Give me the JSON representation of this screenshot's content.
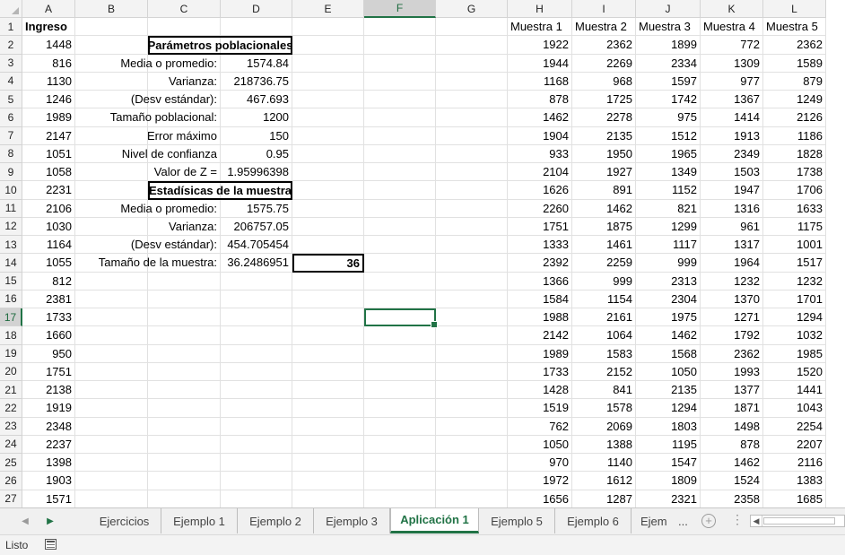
{
  "columns": [
    "A",
    "B",
    "C",
    "D",
    "E",
    "F",
    "G",
    "H",
    "I",
    "J",
    "K",
    "L"
  ],
  "selected_column": "F",
  "selected_row": 17,
  "rows": [
    "1",
    "2",
    "3",
    "4",
    "5",
    "6",
    "7",
    "8",
    "9",
    "10",
    "11",
    "12",
    "13",
    "14",
    "15",
    "16",
    "17",
    "18",
    "19",
    "20",
    "21",
    "22",
    "23",
    "24",
    "25",
    "26",
    "27"
  ],
  "column_a": {
    "header": "Ingreso",
    "values": [
      "1448",
      "816",
      "1130",
      "1246",
      "1989",
      "2147",
      "1051",
      "1058",
      "2231",
      "2106",
      "1030",
      "1164",
      "1055",
      "812",
      "2381",
      "1733",
      "1660",
      "950",
      "1751",
      "2138",
      "1919",
      "2348",
      "2237",
      "1398",
      "1903",
      "1571"
    ]
  },
  "params": {
    "title_poblacion": "Parámetros poblacionales",
    "media_label": "Media o promedio:",
    "media_value": "1574.84",
    "varianza_label": "Varianza:",
    "varianza_value": "218736.75",
    "desv_label": "(Desv estándar):",
    "desv_value": "467.693",
    "tamano_label": "Tamaño poblacional:",
    "tamano_value": "1200",
    "error_label": "Error máximo",
    "error_value": "150",
    "nivel_label": "Nivel de confianza",
    "nivel_value": "0.95",
    "z_label": "Valor de Z =",
    "z_value": "1.95996398",
    "title_muestra": "Estadísicas de la muestra",
    "m_media_label": "Media o promedio:",
    "m_media_value": "1575.75",
    "m_varianza_label": "Varianza:",
    "m_varianza_value": "206757.05",
    "m_desv_label": "(Desv estándar):",
    "m_desv_value": "454.705454",
    "m_tamano_label": "Tamaño de la muestra:",
    "m_tamano_value": "36.2486951",
    "m_tamano_rounded": "36"
  },
  "samples": {
    "headers": [
      "Muestra 1",
      "Muestra 2",
      "Muestra 3",
      "Muestra 4",
      "Muestra 5"
    ],
    "rows": [
      [
        "1922",
        "2362",
        "1899",
        "772",
        "2362"
      ],
      [
        "1944",
        "2269",
        "2334",
        "1309",
        "1589"
      ],
      [
        "1168",
        "968",
        "1597",
        "977",
        "879"
      ],
      [
        "878",
        "1725",
        "1742",
        "1367",
        "1249"
      ],
      [
        "1462",
        "2278",
        "975",
        "1414",
        "2126"
      ],
      [
        "1904",
        "2135",
        "1512",
        "1913",
        "1186"
      ],
      [
        "933",
        "1950",
        "1965",
        "2349",
        "1828"
      ],
      [
        "2104",
        "1927",
        "1349",
        "1503",
        "1738"
      ],
      [
        "1626",
        "891",
        "1152",
        "1947",
        "1706"
      ],
      [
        "2260",
        "1462",
        "821",
        "1316",
        "1633"
      ],
      [
        "1751",
        "1875",
        "1299",
        "961",
        "1175"
      ],
      [
        "1333",
        "1461",
        "1117",
        "1317",
        "1001"
      ],
      [
        "2392",
        "2259",
        "999",
        "1964",
        "1517"
      ],
      [
        "1366",
        "999",
        "2313",
        "1232",
        "1232"
      ],
      [
        "1584",
        "1154",
        "2304",
        "1370",
        "1701"
      ],
      [
        "1988",
        "2161",
        "1975",
        "1271",
        "1294"
      ],
      [
        "2142",
        "1064",
        "1462",
        "1792",
        "1032"
      ],
      [
        "1989",
        "1583",
        "1568",
        "2362",
        "1985"
      ],
      [
        "1733",
        "2152",
        "1050",
        "1993",
        "1520"
      ],
      [
        "1428",
        "841",
        "2135",
        "1377",
        "1441"
      ],
      [
        "1519",
        "1578",
        "1294",
        "1871",
        "1043"
      ],
      [
        "762",
        "2069",
        "1803",
        "1498",
        "2254"
      ],
      [
        "1050",
        "1388",
        "1195",
        "878",
        "2207"
      ],
      [
        "970",
        "1140",
        "1547",
        "1462",
        "2116"
      ],
      [
        "1972",
        "1612",
        "1809",
        "1524",
        "1383"
      ],
      [
        "1656",
        "1287",
        "2321",
        "2358",
        "1685"
      ]
    ]
  },
  "sheet_tabs": [
    {
      "label": "Ejercicios",
      "active": false
    },
    {
      "label": "Ejemplo 1",
      "active": false
    },
    {
      "label": "Ejemplo 2",
      "active": false
    },
    {
      "label": "Ejemplo 3",
      "active": false
    },
    {
      "label": "Aplicación 1",
      "active": true
    },
    {
      "label": "Ejemplo 5",
      "active": false
    },
    {
      "label": "Ejemplo 6",
      "active": false
    },
    {
      "label": "Ejemp",
      "active": false
    }
  ],
  "tabs_more": "...",
  "add_sheet": "+",
  "status": {
    "text": "Listo"
  },
  "icons": {
    "nav_prev": "triangle-left-icon",
    "nav_next": "triangle-right-icon",
    "add_sheet": "plus-circle-icon",
    "options": "vertical-dots-icon",
    "macro": "macro-record-icon"
  },
  "colors": {
    "accent": "#217346",
    "header_bg": "#f3f3f3",
    "gridline": "#e1e1e1"
  }
}
